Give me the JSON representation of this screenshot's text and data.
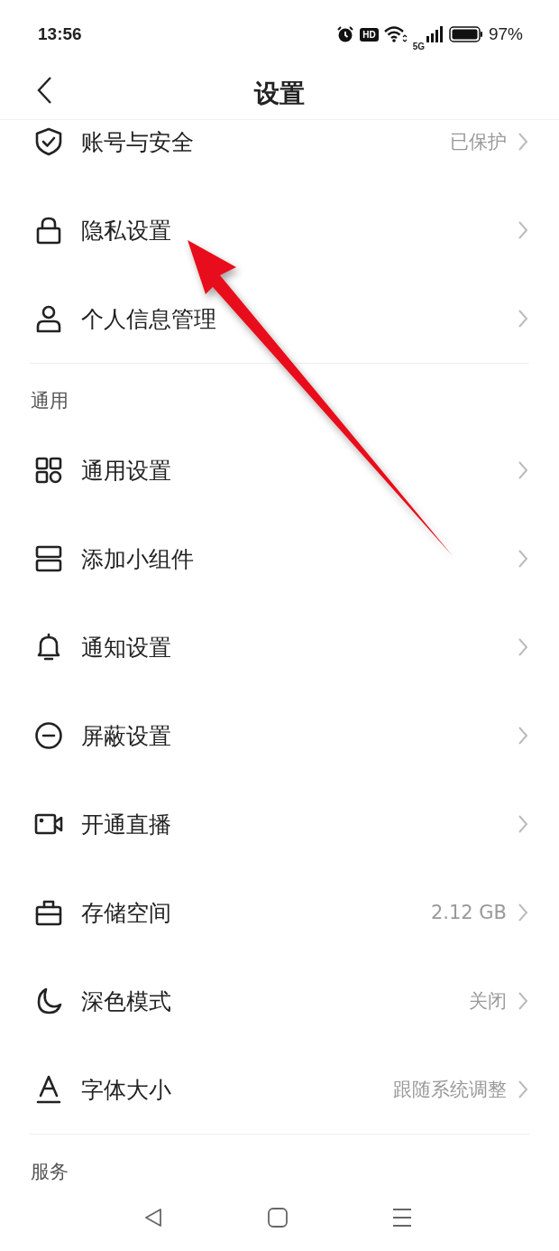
{
  "status_bar": {
    "time": "13:56",
    "hd": "HD",
    "network": "5G",
    "battery": "97%"
  },
  "header": {
    "title": "设置"
  },
  "sections": [
    {
      "items": [
        {
          "label": "账号与安全",
          "value": "已保护"
        },
        {
          "label": "隐私设置"
        },
        {
          "label": "个人信息管理"
        }
      ]
    },
    {
      "title": "通用",
      "items": [
        {
          "label": "通用设置"
        },
        {
          "label": "添加小组件"
        },
        {
          "label": "通知设置"
        },
        {
          "label": "屏蔽设置"
        },
        {
          "label": "开通直播"
        },
        {
          "label": "存储空间",
          "value": "2.12 GB"
        },
        {
          "label": "深色模式",
          "value": "关闭"
        },
        {
          "label": "字体大小",
          "value": "跟随系统调整"
        }
      ]
    },
    {
      "title": "服务"
    }
  ]
}
